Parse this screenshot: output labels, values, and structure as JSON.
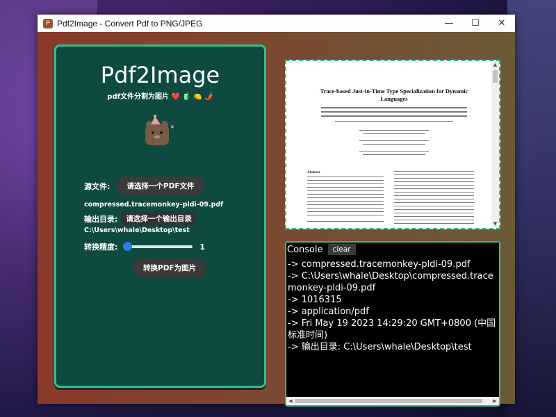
{
  "window": {
    "title": "Pdf2Image - Convert Pdf to PNG/JPEG",
    "icon": "pdf-app-icon",
    "controls": {
      "minimize": "—",
      "maximize": "☐",
      "close": "✕"
    }
  },
  "left_panel": {
    "app_title": "Pdf2Image",
    "subtitle": "pdf文件分割为图片 ❤️ 🧃 🍋 🌶️",
    "source_label": "源文件:",
    "source_button": "请选择一个PDF文件",
    "source_file": "compressed.tracemonkey-pldi-09.pdf",
    "output_label": "输出目录:",
    "output_button": "请选择一个输出目录",
    "output_path": "C:\\Users\\whale\\Desktop\\test",
    "precision_label": "转换精度:",
    "precision_value": "1",
    "precision_fraction": 0.0,
    "convert_button": "转换PDF为图片"
  },
  "preview": {
    "doc_title_line1": "Trace-based Just-in-Time Type Specialization for Dynamic",
    "doc_title_line2": "Languages",
    "doc_section": "Abstract"
  },
  "console": {
    "label": "Console",
    "clear_button": "clear",
    "lines": [
      "-> compressed.tracemonkey-pldi-09.pdf",
      "-> C:\\Users\\whale\\Desktop\\compressed.tracemonkey-pldi-09.pdf",
      "-> 1016315",
      "-> application/pdf",
      "-> Fri May 19 2023 14:29:20 GMT+0800 (中国标准时间)",
      "-> 输出目录: C:\\Users\\whale\\Desktop\\test"
    ]
  },
  "colors": {
    "panel_bg": "#0e4a40",
    "panel_border": "#2fbf8f",
    "slider_accent": "#2a7fe0"
  }
}
